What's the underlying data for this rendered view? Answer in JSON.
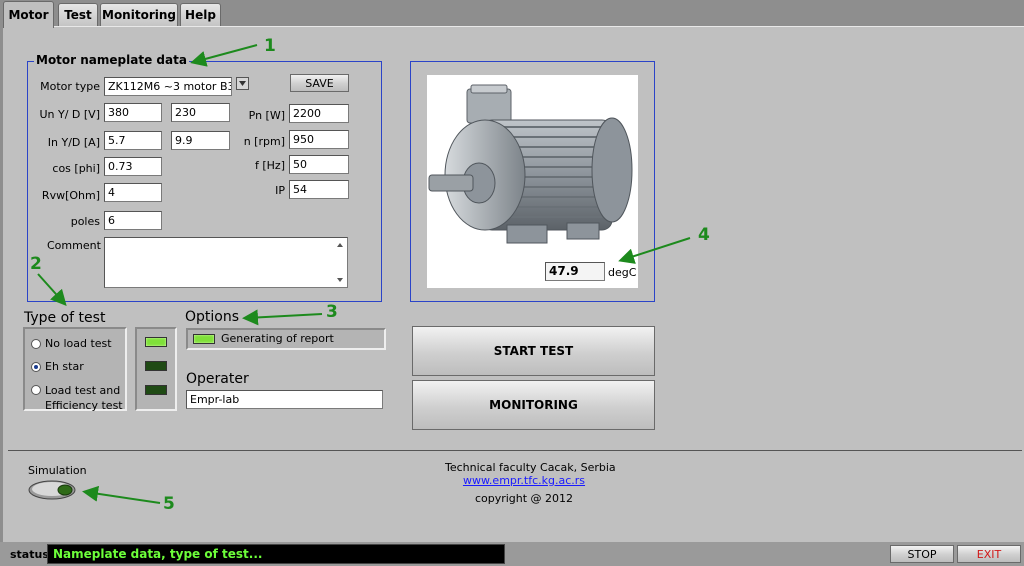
{
  "tabs": [
    {
      "label": "Motor",
      "active": true
    },
    {
      "label": "Test",
      "active": false
    },
    {
      "label": "Monitoring",
      "active": false
    },
    {
      "label": "Help",
      "active": false
    }
  ],
  "nameplate": {
    "title": "Motor nameplate data",
    "motor_type_label": "Motor type",
    "motor_type_value": "ZK112M6 ~3 motor B3",
    "save_label": "SAVE",
    "un_label": "Un Y/ D [V]",
    "un_y": "380",
    "un_d": "230",
    "in_label": "In Y/D  [A]",
    "in_y": "5.7",
    "in_d": "9.9",
    "cos_label": "cos [phi]",
    "cos_value": "0.73",
    "rvw_label": "Rvw[Ohm]",
    "rvw_value": "4",
    "poles_label": "poles",
    "poles_value": "6",
    "pn_label": "Pn [W]",
    "pn_value": "2200",
    "n_label": "n [rpm]",
    "n_value": "950",
    "f_label": "f [Hz]",
    "f_value": "50",
    "ip_label": "IP",
    "ip_value": "54",
    "comment_label": "Comment",
    "comment_value": ""
  },
  "motor_image": {
    "temperature": "47.9",
    "temperature_unit": "degC"
  },
  "type_of_test": {
    "title": "Type of test",
    "options": [
      {
        "label": "No load test",
        "selected": false,
        "led_on": true
      },
      {
        "label": "Eh star",
        "selected": true,
        "led_on": false
      },
      {
        "label": "Load test and",
        "label2": "Efficiency test",
        "selected": false,
        "led_on": false
      }
    ]
  },
  "options": {
    "title": "Options",
    "generate_report_label": "Generating of report"
  },
  "operator": {
    "label": "Operater",
    "value": "Empr-lab"
  },
  "buttons": {
    "start_test": "START TEST",
    "monitoring": "MONITORING",
    "stop": "STOP",
    "exit": "EXIT"
  },
  "simulation": {
    "label": "Simulation"
  },
  "footer": {
    "line1": "Technical faculty Cacak, Serbia",
    "link": "www.empr.tfc.kg.ac.rs",
    "copyright": "copyright @ 2012"
  },
  "status": {
    "label": "status",
    "message": "Nameplate data, type of test..."
  },
  "annotations": [
    "1",
    "2",
    "3",
    "4",
    "5"
  ],
  "colors": {
    "group_border": "#2b44c8",
    "annotation_green": "#1d8a1d",
    "status_text": "#6dff3a",
    "exit_red": "#d01818"
  }
}
